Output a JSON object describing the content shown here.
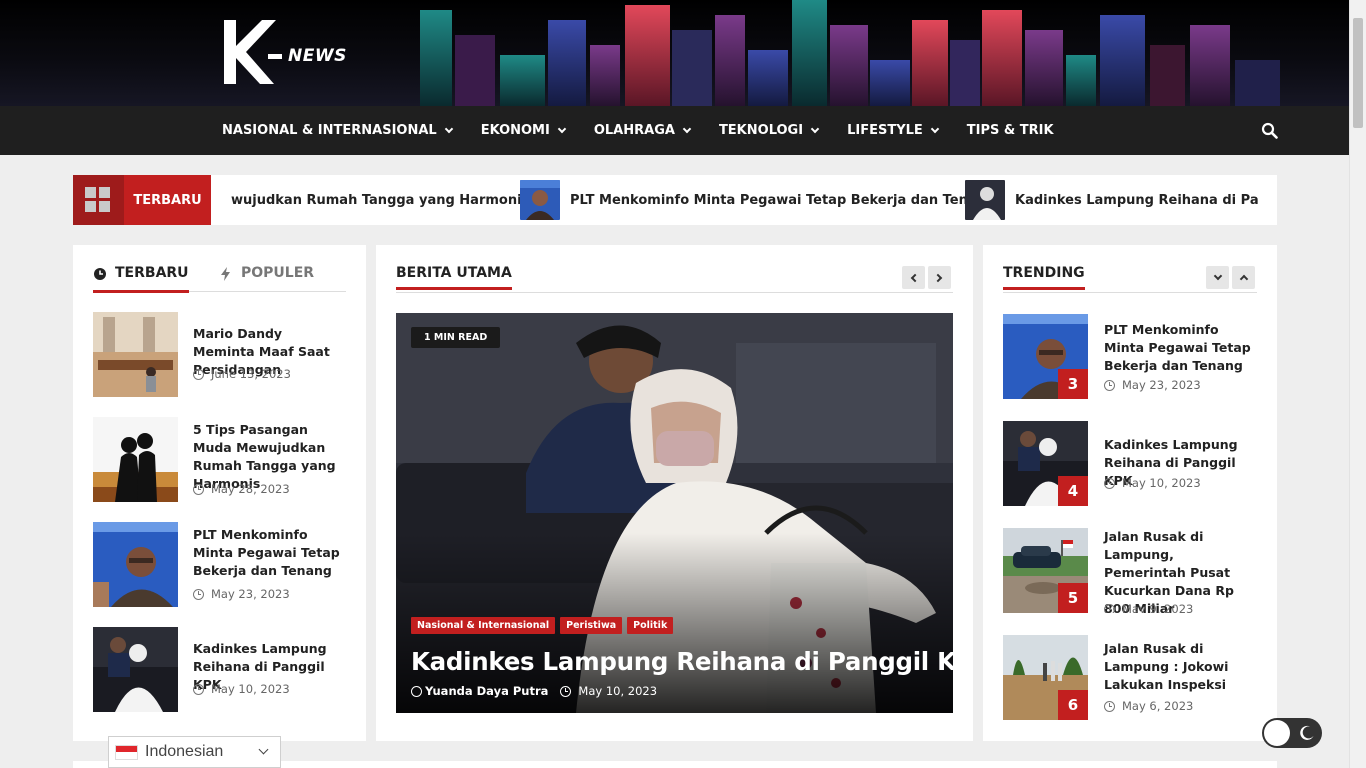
{
  "site": {
    "logo_text": "NEWS",
    "logo_letter": "K"
  },
  "nav": {
    "items": [
      {
        "label": "NASIONAL & INTERNASIONAL",
        "has_dropdown": true
      },
      {
        "label": "EKONOMI",
        "has_dropdown": true
      },
      {
        "label": "OLAHRAGA",
        "has_dropdown": true
      },
      {
        "label": "TEKNOLOGI",
        "has_dropdown": true
      },
      {
        "label": "LIFESTYLE",
        "has_dropdown": true
      },
      {
        "label": "TIPS & TRIK",
        "has_dropdown": false
      }
    ],
    "search_icon": "search-icon"
  },
  "ticker": {
    "label": "TERBARU",
    "items": [
      {
        "title": "wujudkan Rumah Tangga yang Harmonis"
      },
      {
        "title": "PLT Menkominfo Minta Pegawai Tetap Bekerja dan Tenang"
      },
      {
        "title": "Kadinkes Lampung Reihana di Panggil K"
      }
    ]
  },
  "left_panel": {
    "tabs": [
      {
        "label": "TERBARU",
        "icon": "clock-icon",
        "active": true
      },
      {
        "label": "POPULER",
        "icon": "bolt-icon",
        "active": false
      }
    ],
    "posts": [
      {
        "title": "Mario Dandy Meminta Maaf Saat Persidangan",
        "date": "June 13, 2023"
      },
      {
        "title": "5 Tips Pasangan Muda Mewujudkan Rumah Tangga yang Harmonis",
        "date": "May 28, 2023"
      },
      {
        "title": "PLT Menkominfo Minta Pegawai Tetap Bekerja dan Tenang",
        "date": "May 23, 2023"
      },
      {
        "title": "Kadinkes Lampung Reihana di Panggil KPK",
        "date": "May 10, 2023"
      }
    ]
  },
  "main": {
    "section_title": "BERITA UTAMA",
    "featured": {
      "read_time": "1 MIN READ",
      "categories": [
        "Nasional & Internasional",
        "Peristiwa",
        "Politik"
      ],
      "title": "Kadinkes Lampung Reihana di Panggil KPK",
      "author": "Yuanda Daya Putra",
      "date": "May 10, 2023"
    }
  },
  "trending": {
    "section_title": "TRENDING",
    "items": [
      {
        "rank": "3",
        "title": "PLT Menkominfo Minta Pegawai Tetap Bekerja dan Tenang",
        "date": "May 23, 2023"
      },
      {
        "rank": "4",
        "title": "Kadinkes Lampung Reihana di Panggil KPK",
        "date": "May 10, 2023"
      },
      {
        "rank": "5",
        "title": "Jalan Rusak di Lampung, Pemerintah Pusat Kucurkan Dana Rp 800 Miliar",
        "date": "May 9, 2023"
      },
      {
        "rank": "6",
        "title": "Jalan Rusak di Lampung : Jokowi Lakukan Inspeksi",
        "date": "May 6, 2023"
      }
    ]
  },
  "language": {
    "selected": "Indonesian"
  },
  "theme": {
    "accent": "#c21f1f",
    "dark_accent": "#9e1b1b",
    "nav_bg": "#1f1f1f"
  }
}
